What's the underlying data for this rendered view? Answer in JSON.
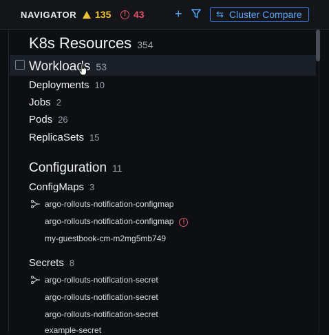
{
  "header": {
    "title": "NAVIGATOR",
    "warning_count": "135",
    "error_count": "43",
    "compare_label": "Cluster Compare"
  },
  "k8s": {
    "label": "K8s Resources",
    "count": "354"
  },
  "workloads": {
    "label": "Workloads",
    "count": "53",
    "items": [
      {
        "label": "Deployments",
        "count": "10"
      },
      {
        "label": "Jobs",
        "count": "2"
      },
      {
        "label": "Pods",
        "count": "26"
      },
      {
        "label": "ReplicaSets",
        "count": "15"
      }
    ]
  },
  "configuration": {
    "label": "Configuration",
    "count": "11"
  },
  "configmaps": {
    "label": "ConfigMaps",
    "count": "3",
    "items": [
      {
        "label": "argo-rollouts-notification-configmap"
      },
      {
        "label": "argo-rollouts-notification-configmap"
      },
      {
        "label": "my-guestbook-cm-m2mg5mb749"
      }
    ]
  },
  "secrets": {
    "label": "Secrets",
    "count": "8",
    "items": [
      {
        "label": "argo-rollouts-notification-secret"
      },
      {
        "label": "argo-rollouts-notification-secret"
      },
      {
        "label": "argo-rollouts-notification-secret"
      },
      {
        "label": "example-secret"
      }
    ]
  },
  "colors": {
    "warning": "#f0c330",
    "error": "#e2566b",
    "accent": "#5aa7ff",
    "selected": "#1b2028"
  }
}
